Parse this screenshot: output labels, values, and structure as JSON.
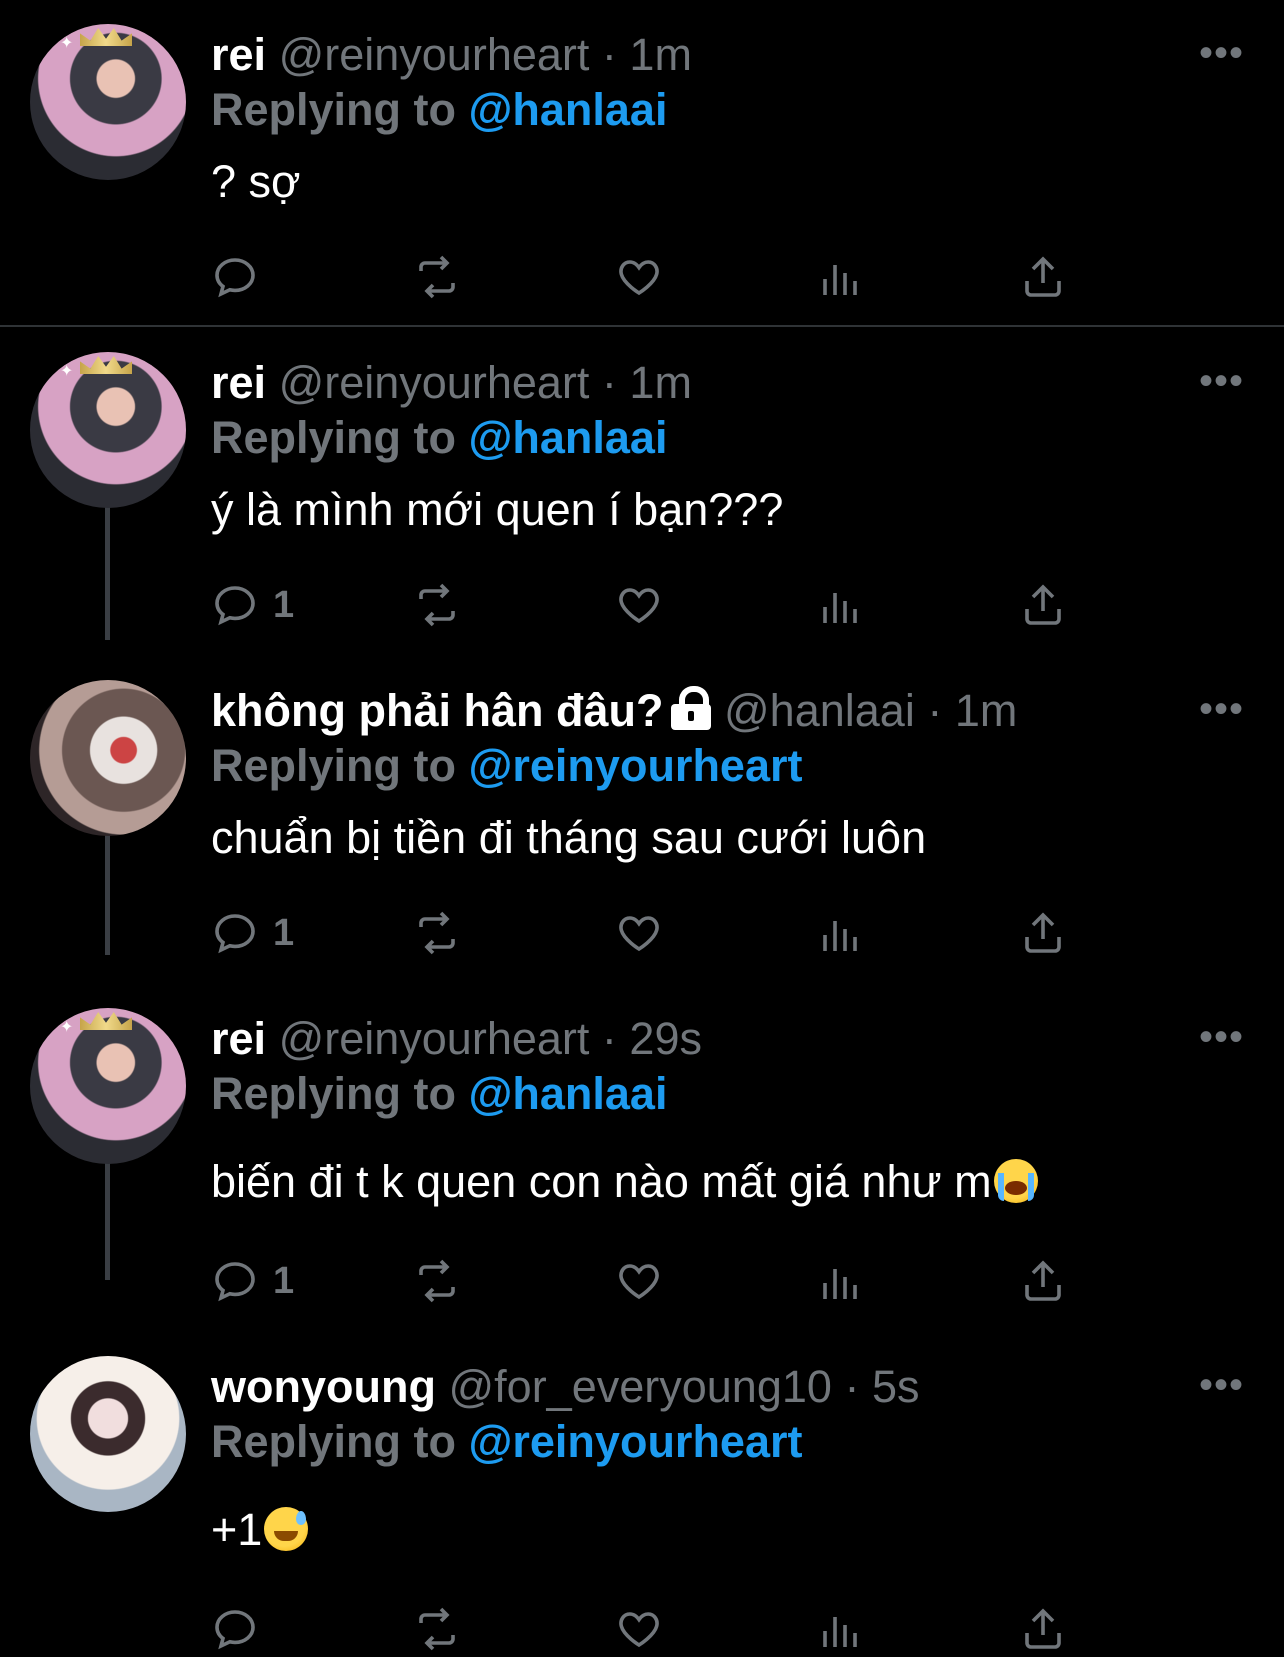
{
  "tweets": [
    {
      "name": "rei",
      "handle": "@reinyourheart",
      "time": "1m",
      "reply_prefix": "Replying to",
      "reply_to": "@hanlaai",
      "text": "? sợ",
      "reply_count": "",
      "more": "•••"
    },
    {
      "name": "rei",
      "handle": "@reinyourheart",
      "time": "1m",
      "reply_prefix": "Replying to",
      "reply_to": "@hanlaai",
      "text": "ý là mình mới quen í bạn???",
      "reply_count": "1",
      "more": "•••"
    },
    {
      "name": "không phải hân đâu?",
      "handle": "@hanlaai",
      "time": "1m",
      "reply_prefix": "Replying to",
      "reply_to": "@reinyourheart",
      "text": "chuẩn bị tiền đi tháng sau cưới luôn",
      "reply_count": "1",
      "more": "•••",
      "protected_icon": "lock-icon"
    },
    {
      "name": "rei",
      "handle": "@reinyourheart",
      "time": "29s",
      "reply_prefix": "Replying to",
      "reply_to": "@hanlaai",
      "text": "biến đi t k quen con nào mất giá như m",
      "emoji": "loudly-crying-face",
      "reply_count": "1",
      "more": "•••"
    },
    {
      "name": "wonyoung",
      "handle": "@for_everyoung10",
      "time": "5s",
      "reply_prefix": "Replying to",
      "reply_to": "@reinyourheart",
      "text": "+1",
      "emoji": "grinning-face-with-sweat",
      "reply_count": "",
      "more": "•••"
    }
  ],
  "separator": "·",
  "action_icons": [
    "reply-icon",
    "retweet-icon",
    "like-icon",
    "views-icon",
    "share-icon"
  ],
  "colors": {
    "background": "#000000",
    "text": "#ffffff",
    "secondary": "#71767b",
    "link": "#1d9bf0",
    "thread_line": "#3a3e44",
    "divider": "#2f3336"
  }
}
